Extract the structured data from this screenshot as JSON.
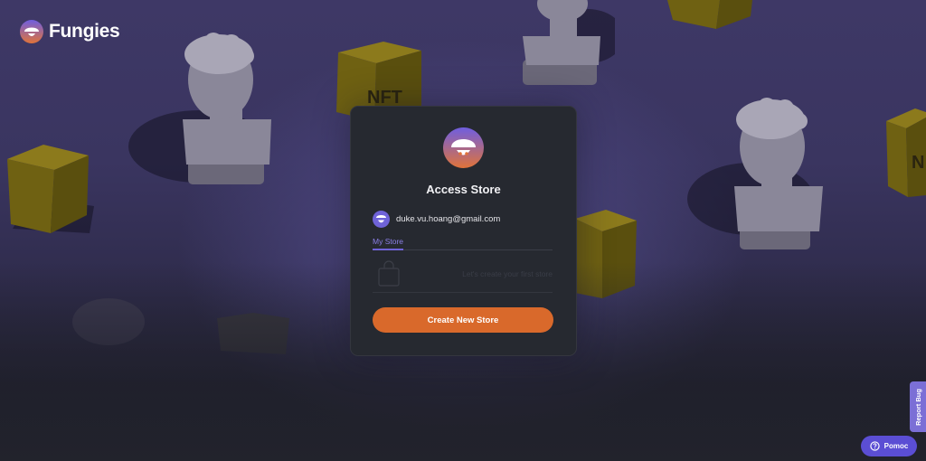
{
  "brand": {
    "name": "Fungies",
    "logo_icon": "mushroom-smile-logo-icon"
  },
  "decor": {
    "cube_text": "NFT",
    "cube_text_partial": "N"
  },
  "card": {
    "title": "Access Store",
    "avatar_icon": "mushroom-avatar-icon",
    "user": {
      "email": "duke.vu.hoang@gmail.com",
      "avatar_icon": "smiley-avatar-icon"
    },
    "tabs": [
      {
        "label": "My Store",
        "active": true
      }
    ],
    "empty_state": {
      "icon": "shopping-bag-icon",
      "text": "Let's create your first store"
    },
    "create_button": "Create New Store"
  },
  "widgets": {
    "report_bug": "Report Bug",
    "help": {
      "label": "Pomoc",
      "icon": "question-circle-icon"
    }
  },
  "colors": {
    "accent_orange": "#d9692b",
    "accent_purple": "#6f63d8",
    "card_bg": "#262930"
  }
}
